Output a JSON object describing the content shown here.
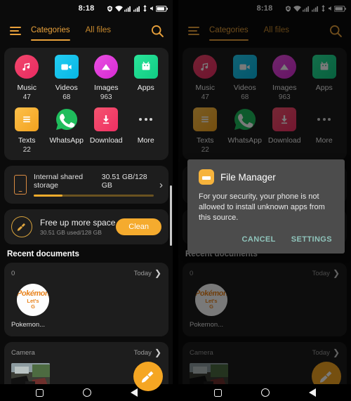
{
  "statusbar": {
    "time": "8:18",
    "icons": [
      "alarm-shield-icon",
      "wifi-icon",
      "signal-1-icon",
      "signal-2-icon",
      "network-speed-icon",
      "mute-icon",
      "battery-icon"
    ]
  },
  "appbar": {
    "menu": "menu-icon",
    "tabs": [
      {
        "label": "Categories",
        "active": true
      },
      {
        "label": "All files",
        "active": false
      }
    ],
    "search": "search-icon"
  },
  "categories": [
    {
      "label": "Music",
      "count": "47",
      "icon": "music-note-icon",
      "color": "#f0385f",
      "shape": "circle"
    },
    {
      "label": "Videos",
      "count": "68",
      "icon": "video-camera-icon",
      "color": "#0bc3ea",
      "shape": "square"
    },
    {
      "label": "Images",
      "count": "963",
      "icon": "image-mountain-icon",
      "color": "#e33ce0",
      "shape": "circle"
    },
    {
      "label": "Apps",
      "count": "",
      "icon": "android-robot-icon",
      "color": "#1fd68e",
      "shape": "square"
    },
    {
      "label": "Texts",
      "count": "22",
      "icon": "document-lines-icon",
      "color": "#f5ae28",
      "shape": "square"
    },
    {
      "label": "WhatsApp",
      "count": "",
      "icon": "whatsapp-icon",
      "color": "#1fbd5c",
      "shape": "plain"
    },
    {
      "label": "Download",
      "count": "",
      "icon": "download-arrow-icon",
      "color": "#f2416b",
      "shape": "square"
    },
    {
      "label": "More",
      "count": "",
      "icon": "more-dots-icon",
      "color": "#cfcfcf",
      "shape": "dots"
    }
  ],
  "storage": {
    "icon": "phone-icon",
    "title": "Internal shared storage",
    "value": "30.51 GB/128 GB",
    "percent": 24,
    "chevron": "chevron-right-icon"
  },
  "freeup": {
    "icon": "broom-icon",
    "title": "Free up more space",
    "subtitle": "30.51 GB used/128 GB",
    "button": "Clean"
  },
  "recent_section": {
    "title": "Recent documents"
  },
  "recent_cards": [
    {
      "name": "0",
      "when": "Today",
      "chevron": "chevron-right-icon",
      "item": {
        "label": "Pokemon...",
        "icon": "pokemon-lets-go-icon",
        "line1": "Pokémon",
        "line2": "Let's",
        "line3": "G"
      }
    },
    {
      "name": "Camera",
      "when": "Today",
      "chevron": "chevron-right-icon",
      "item": {
        "label": "",
        "icon": "photo-thumbnail-icon"
      }
    }
  ],
  "fab": {
    "icon": "broom-icon",
    "color": "#f5a623"
  },
  "navbar": {
    "buttons": [
      "recents-square-icon",
      "home-circle-icon",
      "back-triangle-icon"
    ]
  },
  "dialog": {
    "icon": "file-manager-icon",
    "title": "File Manager",
    "message": "For your security, your phone is not allowed to install unknown apps from this source.",
    "cancel": "CANCEL",
    "settings": "SETTINGS",
    "accent": "#8fc4bb"
  }
}
